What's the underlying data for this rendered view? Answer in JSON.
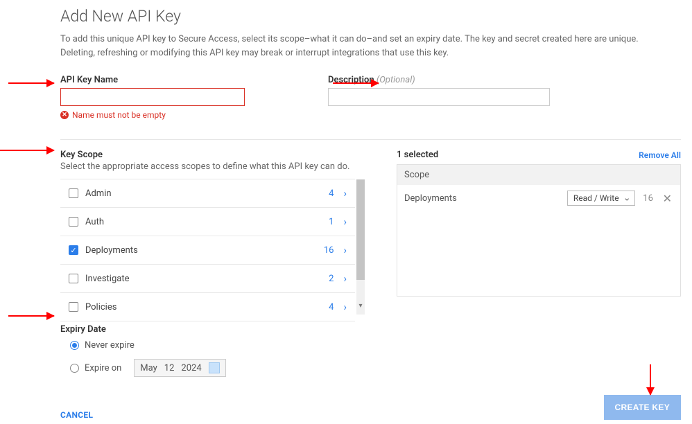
{
  "header": {
    "title": "Add New API Key",
    "description": "To add this unique API key to Secure Access, select its scope–what it can do–and set an expiry date. The key and secret created here are unique. Deleting, refreshing or modifying this API key may break or interrupt integrations that use this key."
  },
  "fields": {
    "name_label": "API Key Name",
    "name_value": "",
    "name_error": "Name must not be empty",
    "desc_label": "Description",
    "desc_optional": "(Optional)",
    "desc_value": ""
  },
  "scope": {
    "heading": "Key Scope",
    "subtext": "Select the appropriate access scopes to define what this API key can do.",
    "items": [
      {
        "label": "Admin",
        "count": "4",
        "checked": false
      },
      {
        "label": "Auth",
        "count": "1",
        "checked": false
      },
      {
        "label": "Deployments",
        "count": "16",
        "checked": true
      },
      {
        "label": "Investigate",
        "count": "2",
        "checked": false
      },
      {
        "label": "Policies",
        "count": "4",
        "checked": false
      }
    ]
  },
  "selected": {
    "heading": "1 selected",
    "remove_all": "Remove All",
    "col_header": "Scope",
    "rows": [
      {
        "name": "Deployments",
        "permission": "Read / Write",
        "count": "16"
      }
    ]
  },
  "expiry": {
    "heading": "Expiry Date",
    "never_label": "Never expire",
    "on_label": "Expire on",
    "date": {
      "month": "May",
      "day": "12",
      "year": "2024"
    }
  },
  "footer": {
    "cancel": "CANCEL",
    "create": "CREATE KEY"
  }
}
